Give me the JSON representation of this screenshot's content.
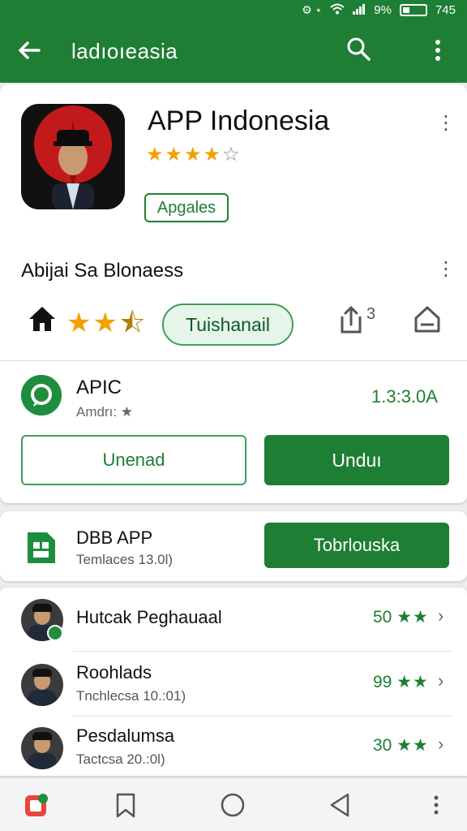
{
  "status_bar": {
    "icons_left": "⚙ ⋆",
    "battery_percent": "9%",
    "time": "745"
  },
  "app_bar": {
    "title": "ladıoıeasia"
  },
  "app": {
    "name": "APP Indonesia",
    "rating_stars": 4,
    "chip_label": "Apgales",
    "developer": "Abijai Sa Blonaess",
    "secondary_stars": 2.5,
    "pill_label": "Tuishanail",
    "share_count": "3"
  },
  "package": {
    "name": "APIC",
    "sub": "Amdrı: ★",
    "version": "1.3:3.0A",
    "left_button": "Unenad",
    "right_button": "Unduı"
  },
  "promo": {
    "name": "DBB APP",
    "sub": "Temlaces 13.0l)",
    "button": "Tobrlouska"
  },
  "list": [
    {
      "title": "Hutcak Peghauaal",
      "sub": "",
      "score": "50",
      "stars": "★★"
    },
    {
      "title": "Roohlads",
      "sub": "Tnchlecsa 10.:01)",
      "score": "99",
      "stars": "★★"
    },
    {
      "title": "Pesdalumsa",
      "sub": "Tactcsa 20.:0l)",
      "score": "30",
      "stars": "★★"
    }
  ],
  "colors": {
    "primary": "#1e7e34",
    "star": "#f2a100"
  }
}
